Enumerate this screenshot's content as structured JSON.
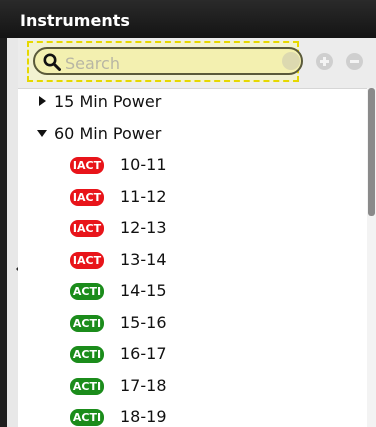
{
  "panel": {
    "title": "Instruments"
  },
  "search": {
    "placeholder": "Search",
    "value": ""
  },
  "toolbar": {
    "icons": [
      "search-icon",
      "clear-icon",
      "add-icon",
      "remove-icon"
    ]
  },
  "tree": {
    "groups": [
      {
        "label": "15 Min Power",
        "expanded": false
      },
      {
        "label": "60 Min Power",
        "expanded": true
      }
    ],
    "items": [
      {
        "badge": "IACT",
        "badge_color": "#e8141a",
        "label": "10-11"
      },
      {
        "badge": "IACT",
        "badge_color": "#e8141a",
        "label": "11-12"
      },
      {
        "badge": "IACT",
        "badge_color": "#e8141a",
        "label": "12-13"
      },
      {
        "badge": "IACT",
        "badge_color": "#e8141a",
        "label": "13-14"
      },
      {
        "badge": "ACTI",
        "badge_color": "#1b8c1b",
        "label": "14-15"
      },
      {
        "badge": "ACTI",
        "badge_color": "#1b8c1b",
        "label": "15-16"
      },
      {
        "badge": "ACTI",
        "badge_color": "#1b8c1b",
        "label": "16-17"
      },
      {
        "badge": "ACTI",
        "badge_color": "#1b8c1b",
        "label": "17-18"
      },
      {
        "badge": "ACTI",
        "badge_color": "#1b8c1b",
        "label": "18-19"
      }
    ]
  },
  "colors": {
    "header_bg": "#1b1b1b",
    "search_highlight": "#e6d800",
    "inactive": "#e8141a",
    "active": "#1b8c1b"
  }
}
